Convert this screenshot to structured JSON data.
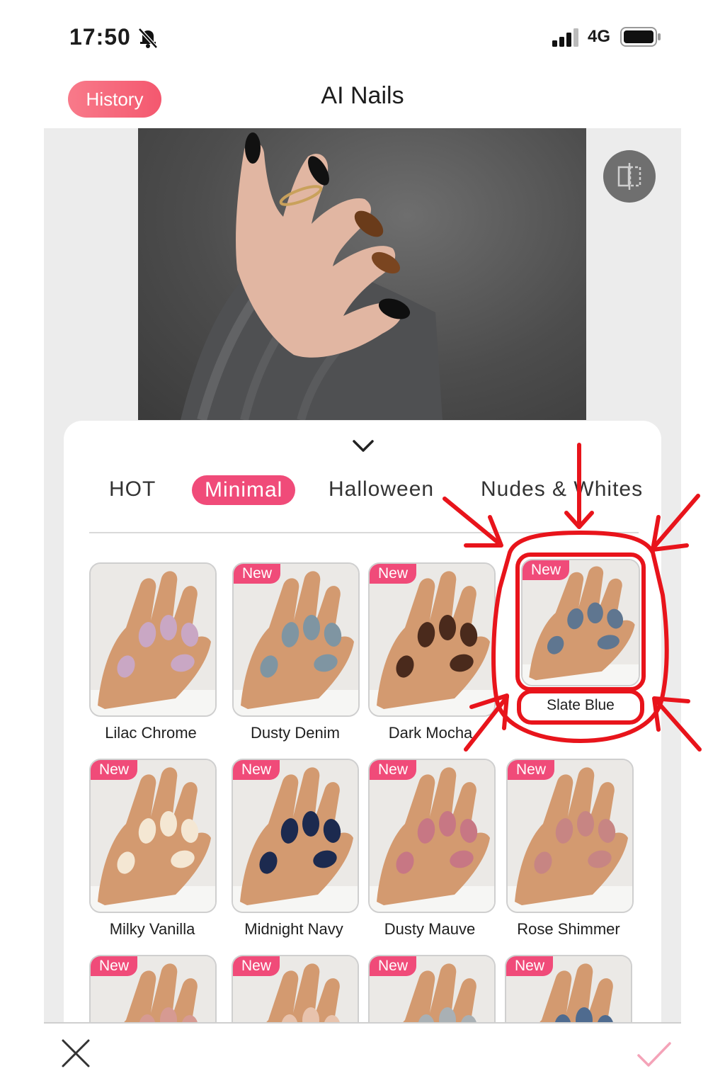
{
  "status_bar": {
    "time": "17:50",
    "network": "4G"
  },
  "header": {
    "history_label": "History",
    "title": "AI Nails"
  },
  "tabs": [
    {
      "label": "HOT",
      "active": false
    },
    {
      "label": "Minimal",
      "active": true
    },
    {
      "label": "Halloween",
      "active": false
    },
    {
      "label": "Nudes & Whites",
      "active": false
    }
  ],
  "styles": [
    {
      "name": "Lilac Chrome",
      "new": false,
      "color": "#c9a7c4"
    },
    {
      "name": "Dusty Denim",
      "new": true,
      "badge": "New",
      "color": "#7f95a2"
    },
    {
      "name": "Dark Mocha",
      "new": true,
      "badge": "New",
      "color": "#4a2a1c"
    },
    {
      "name": "Slate Blue",
      "new": true,
      "badge": "New",
      "color": "#5f7690"
    },
    {
      "name": "Milky Vanilla",
      "new": true,
      "badge": "New",
      "color": "#f4e7d3"
    },
    {
      "name": "Midnight Navy",
      "new": true,
      "badge": "New",
      "color": "#1c2a4f"
    },
    {
      "name": "Dusty Mauve",
      "new": true,
      "badge": "New",
      "color": "#c77784"
    },
    {
      "name": "Rose Shimmer",
      "new": true,
      "badge": "New",
      "color": "#c78583"
    },
    {
      "name": "",
      "new": true,
      "badge": "New",
      "color": "#d69a92"
    },
    {
      "name": "",
      "new": true,
      "badge": "New",
      "color": "#e8c3ad"
    },
    {
      "name": "",
      "new": true,
      "badge": "New",
      "color": "#a9b0b4"
    },
    {
      "name": "",
      "new": true,
      "badge": "New",
      "color": "#4f6b8f"
    }
  ],
  "colors": {
    "accent": "#f04b79",
    "annotation": "#e8141b"
  }
}
